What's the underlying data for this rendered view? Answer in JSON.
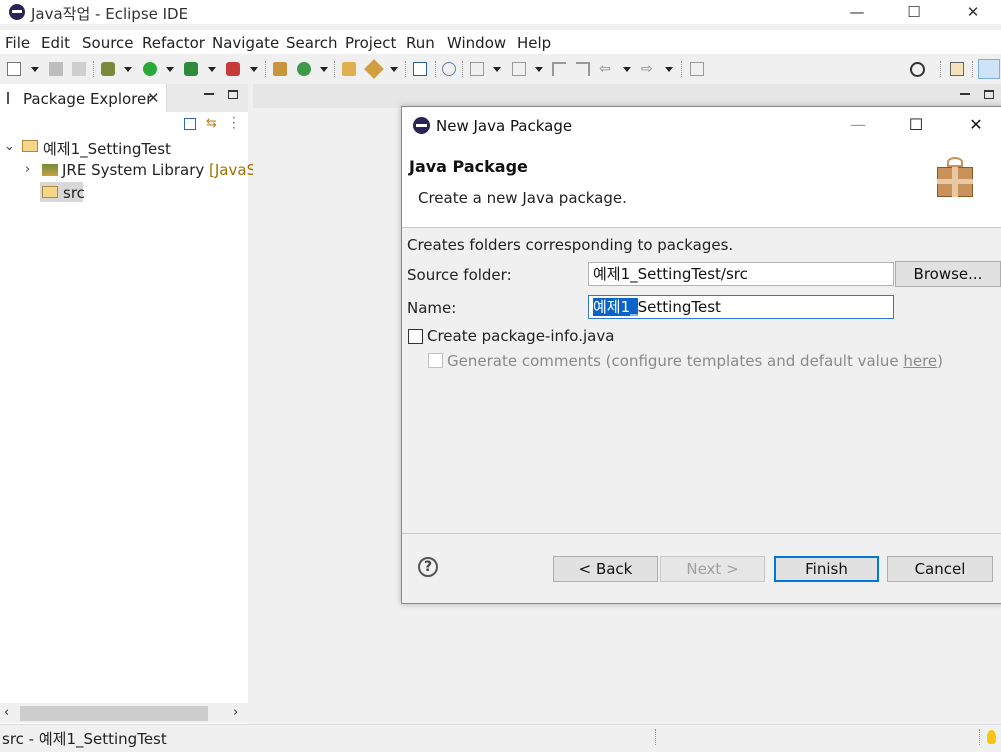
{
  "window": {
    "title": "Java작업 - Eclipse IDE",
    "minimize": "—",
    "maximize": "☐",
    "close": "✕"
  },
  "menu": {
    "items": [
      "File",
      "Edit",
      "Source",
      "Refactor",
      "Navigate",
      "Search",
      "Project",
      "Run",
      "Window",
      "Help"
    ]
  },
  "toolbar": {
    "icons": [
      "new-icon",
      "save-icon",
      "save-all-icon",
      "debug-icon",
      "run-icon",
      "coverage-icon",
      "external-tools-icon",
      "new-java-project-icon",
      "new-class-icon",
      "open-type-icon",
      "task-icon",
      "annotation-icon",
      "back-icon",
      "forward-icon",
      "search-icon",
      "perspective-icon",
      "java-perspective-icon"
    ]
  },
  "package_explorer": {
    "tab_label": "Package Explorer",
    "close": "✕",
    "tree": {
      "project": "예제1_SettingTest",
      "jre": "JRE System Library",
      "jre_suffix": "[JavaSE-",
      "src": "src"
    }
  },
  "status": {
    "text": "src - 예제1_SettingTest"
  },
  "dialog": {
    "title": "New Java Package",
    "heading": "Java Package",
    "description": "Create a new Java package.",
    "intro": "Creates folders corresponding to packages.",
    "source_folder_label": "Source folder:",
    "source_folder_value": "예제1_SettingTest/src",
    "browse_label": "Browse...",
    "name_label": "Name:",
    "name_selected": "예제1_",
    "name_rest": "SettingTest",
    "create_package_info_label": "Create package-info.java",
    "generate_comments_label": "Generate comments (configure templates and default value ",
    "here_link": "here",
    "generate_comments_tail": ")",
    "help": "?",
    "back_label": "< Back",
    "next_label": "Next >",
    "finish_label": "Finish",
    "cancel_label": "Cancel"
  },
  "colors": {
    "accent": "#0078d7",
    "selection": "#0a64c8",
    "jre_suffix": "#a07000"
  }
}
